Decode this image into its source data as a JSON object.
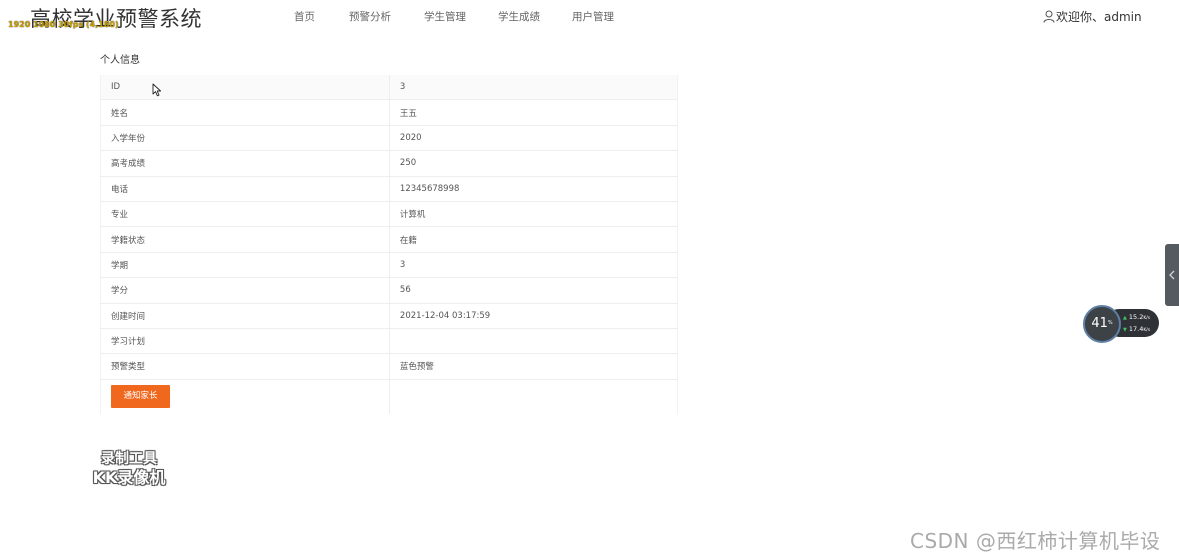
{
  "header": {
    "site_title": "高校学业预警系统",
    "title_overlay": "1920 1080 30fps (4,180)",
    "nav": [
      {
        "label": "首页"
      },
      {
        "label": "预警分析"
      },
      {
        "label": "学生管理"
      },
      {
        "label": "学生成绩"
      },
      {
        "label": "用户管理"
      }
    ],
    "user_greeting": "欢迎你、admin",
    "user_icon": "user-icon"
  },
  "panel": {
    "title": "个人信息",
    "rows": [
      {
        "label": "ID",
        "value": "3"
      },
      {
        "label": "姓名",
        "value": "王五"
      },
      {
        "label": "入学年份",
        "value": "2020"
      },
      {
        "label": "高考成绩",
        "value": "250"
      },
      {
        "label": "电话",
        "value": "12345678998"
      },
      {
        "label": "专业",
        "value": "计算机"
      },
      {
        "label": "学籍状态",
        "value": "在籍"
      },
      {
        "label": "学期",
        "value": "3"
      },
      {
        "label": "学分",
        "value": "56"
      },
      {
        "label": "创建时间",
        "value": "2021-12-04 03:17:59"
      },
      {
        "label": "学习计划",
        "value": ""
      },
      {
        "label": "预警类型",
        "value": "蓝色预警"
      }
    ],
    "notify_button": "通知家长"
  },
  "speed_widget": {
    "percent": "41",
    "percent_unit": "%",
    "upload": "15.2",
    "upload_unit": "K/s",
    "download": "17.4",
    "download_unit": "K/s"
  },
  "watermarks": {
    "recorder_line1": "录制工具",
    "recorder_line2": "KK录像机",
    "csdn": "CSDN @西红柿计算机毕设"
  },
  "colors": {
    "accent_button": "#f0681e",
    "side_tab": "#555a60"
  }
}
